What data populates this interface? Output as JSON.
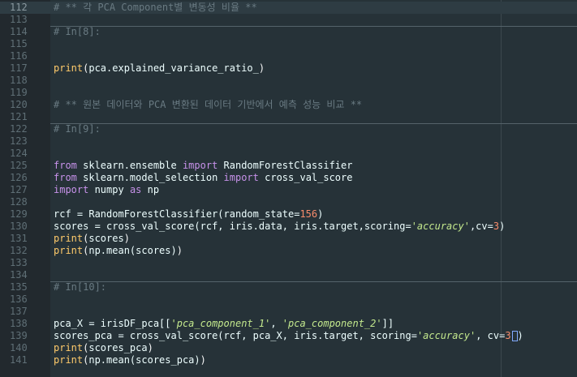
{
  "editor": {
    "lines": [
      {
        "n": "112",
        "hl": true,
        "sep": false,
        "tokens": [
          {
            "t": "comment",
            "v": "# ** 각 PCA Component별 변동성 비율 **"
          }
        ]
      },
      {
        "n": "113",
        "hl": false,
        "sep": false,
        "tokens": []
      },
      {
        "n": "114",
        "hl": false,
        "sep": true,
        "tokens": [
          {
            "t": "comment",
            "v": "# In[8]:"
          }
        ]
      },
      {
        "n": "115",
        "hl": false,
        "sep": false,
        "tokens": []
      },
      {
        "n": "116",
        "hl": false,
        "sep": false,
        "tokens": []
      },
      {
        "n": "117",
        "hl": false,
        "sep": false,
        "tokens": [
          {
            "t": "func",
            "v": "print"
          },
          {
            "t": "paren",
            "v": "("
          },
          {
            "t": "text",
            "v": "pca.explained_variance_ratio_"
          },
          {
            "t": "paren",
            "v": ")"
          }
        ]
      },
      {
        "n": "118",
        "hl": false,
        "sep": false,
        "tokens": []
      },
      {
        "n": "119",
        "hl": false,
        "sep": false,
        "tokens": []
      },
      {
        "n": "120",
        "hl": false,
        "sep": false,
        "tokens": [
          {
            "t": "comment",
            "v": "# ** 원본 데이터와 PCA 변환된 데이터 기반에서 예측 성능 비교 **"
          }
        ]
      },
      {
        "n": "121",
        "hl": false,
        "sep": false,
        "tokens": []
      },
      {
        "n": "122",
        "hl": false,
        "sep": true,
        "tokens": [
          {
            "t": "comment",
            "v": "# In[9]:"
          }
        ]
      },
      {
        "n": "123",
        "hl": false,
        "sep": false,
        "tokens": []
      },
      {
        "n": "124",
        "hl": false,
        "sep": false,
        "tokens": []
      },
      {
        "n": "125",
        "hl": false,
        "sep": false,
        "tokens": [
          {
            "t": "keyword",
            "v": "from"
          },
          {
            "t": "text",
            "v": " sklearn.ensemble "
          },
          {
            "t": "keyword",
            "v": "import"
          },
          {
            "t": "text",
            "v": " RandomForestClassifier"
          }
        ]
      },
      {
        "n": "126",
        "hl": false,
        "sep": false,
        "tokens": [
          {
            "t": "keyword",
            "v": "from"
          },
          {
            "t": "text",
            "v": " sklearn.model_selection "
          },
          {
            "t": "keyword",
            "v": "import"
          },
          {
            "t": "text",
            "v": " cross_val_score"
          }
        ]
      },
      {
        "n": "127",
        "hl": false,
        "sep": false,
        "tokens": [
          {
            "t": "keyword",
            "v": "import"
          },
          {
            "t": "text",
            "v": " numpy "
          },
          {
            "t": "keyword",
            "v": "as"
          },
          {
            "t": "text",
            "v": " np"
          }
        ]
      },
      {
        "n": "128",
        "hl": false,
        "sep": false,
        "tokens": []
      },
      {
        "n": "129",
        "hl": false,
        "sep": false,
        "tokens": [
          {
            "t": "text",
            "v": "rcf = RandomForestClassifier(random_state="
          },
          {
            "t": "number",
            "v": "156"
          },
          {
            "t": "text",
            "v": ")"
          }
        ]
      },
      {
        "n": "130",
        "hl": false,
        "sep": false,
        "tokens": [
          {
            "t": "text",
            "v": "scores = cross_val_score(rcf, iris.data, iris.target,scoring="
          },
          {
            "t": "string",
            "v": "'accuracy'"
          },
          {
            "t": "text",
            "v": ",cv="
          },
          {
            "t": "number",
            "v": "3"
          },
          {
            "t": "text",
            "v": ")"
          }
        ]
      },
      {
        "n": "131",
        "hl": false,
        "sep": false,
        "tokens": [
          {
            "t": "func",
            "v": "print"
          },
          {
            "t": "paren",
            "v": "("
          },
          {
            "t": "text",
            "v": "scores"
          },
          {
            "t": "paren",
            "v": ")"
          }
        ]
      },
      {
        "n": "132",
        "hl": false,
        "sep": false,
        "tokens": [
          {
            "t": "func",
            "v": "print"
          },
          {
            "t": "paren",
            "v": "("
          },
          {
            "t": "text",
            "v": "np.mean(scores)"
          },
          {
            "t": "paren",
            "v": ")"
          }
        ]
      },
      {
        "n": "133",
        "hl": false,
        "sep": false,
        "tokens": []
      },
      {
        "n": "134",
        "hl": false,
        "sep": false,
        "tokens": []
      },
      {
        "n": "135",
        "hl": false,
        "sep": true,
        "tokens": [
          {
            "t": "comment",
            "v": "# In[10]:"
          }
        ]
      },
      {
        "n": "136",
        "hl": false,
        "sep": false,
        "tokens": []
      },
      {
        "n": "137",
        "hl": false,
        "sep": false,
        "tokens": []
      },
      {
        "n": "138",
        "hl": false,
        "sep": false,
        "tokens": [
          {
            "t": "text",
            "v": "pca_X = irisDF_pca[["
          },
          {
            "t": "string",
            "v": "'pca_component_1'"
          },
          {
            "t": "text",
            "v": ", "
          },
          {
            "t": "string",
            "v": "'pca_component_2'"
          },
          {
            "t": "text",
            "v": "]]"
          }
        ]
      },
      {
        "n": "139",
        "hl": false,
        "sep": false,
        "tokens": [
          {
            "t": "text",
            "v": "scores_pca = cross_val_score(rcf, pca_X, iris.target, scoring="
          },
          {
            "t": "string",
            "v": "'accuracy'"
          },
          {
            "t": "text",
            "v": ", cv="
          },
          {
            "t": "number",
            "v": "3"
          },
          {
            "t": "cursor",
            "v": ""
          },
          {
            "t": "text",
            "v": ")"
          }
        ]
      },
      {
        "n": "140",
        "hl": false,
        "sep": false,
        "tokens": [
          {
            "t": "func",
            "v": "print"
          },
          {
            "t": "paren",
            "v": "("
          },
          {
            "t": "text",
            "v": "scores_pca"
          },
          {
            "t": "paren",
            "v": ")"
          }
        ]
      },
      {
        "n": "141",
        "hl": false,
        "sep": false,
        "tokens": [
          {
            "t": "func",
            "v": "print"
          },
          {
            "t": "paren",
            "v": "("
          },
          {
            "t": "text",
            "v": "np.mean(scores_pca)"
          },
          {
            "t": "paren",
            "v": ")"
          }
        ]
      }
    ]
  }
}
